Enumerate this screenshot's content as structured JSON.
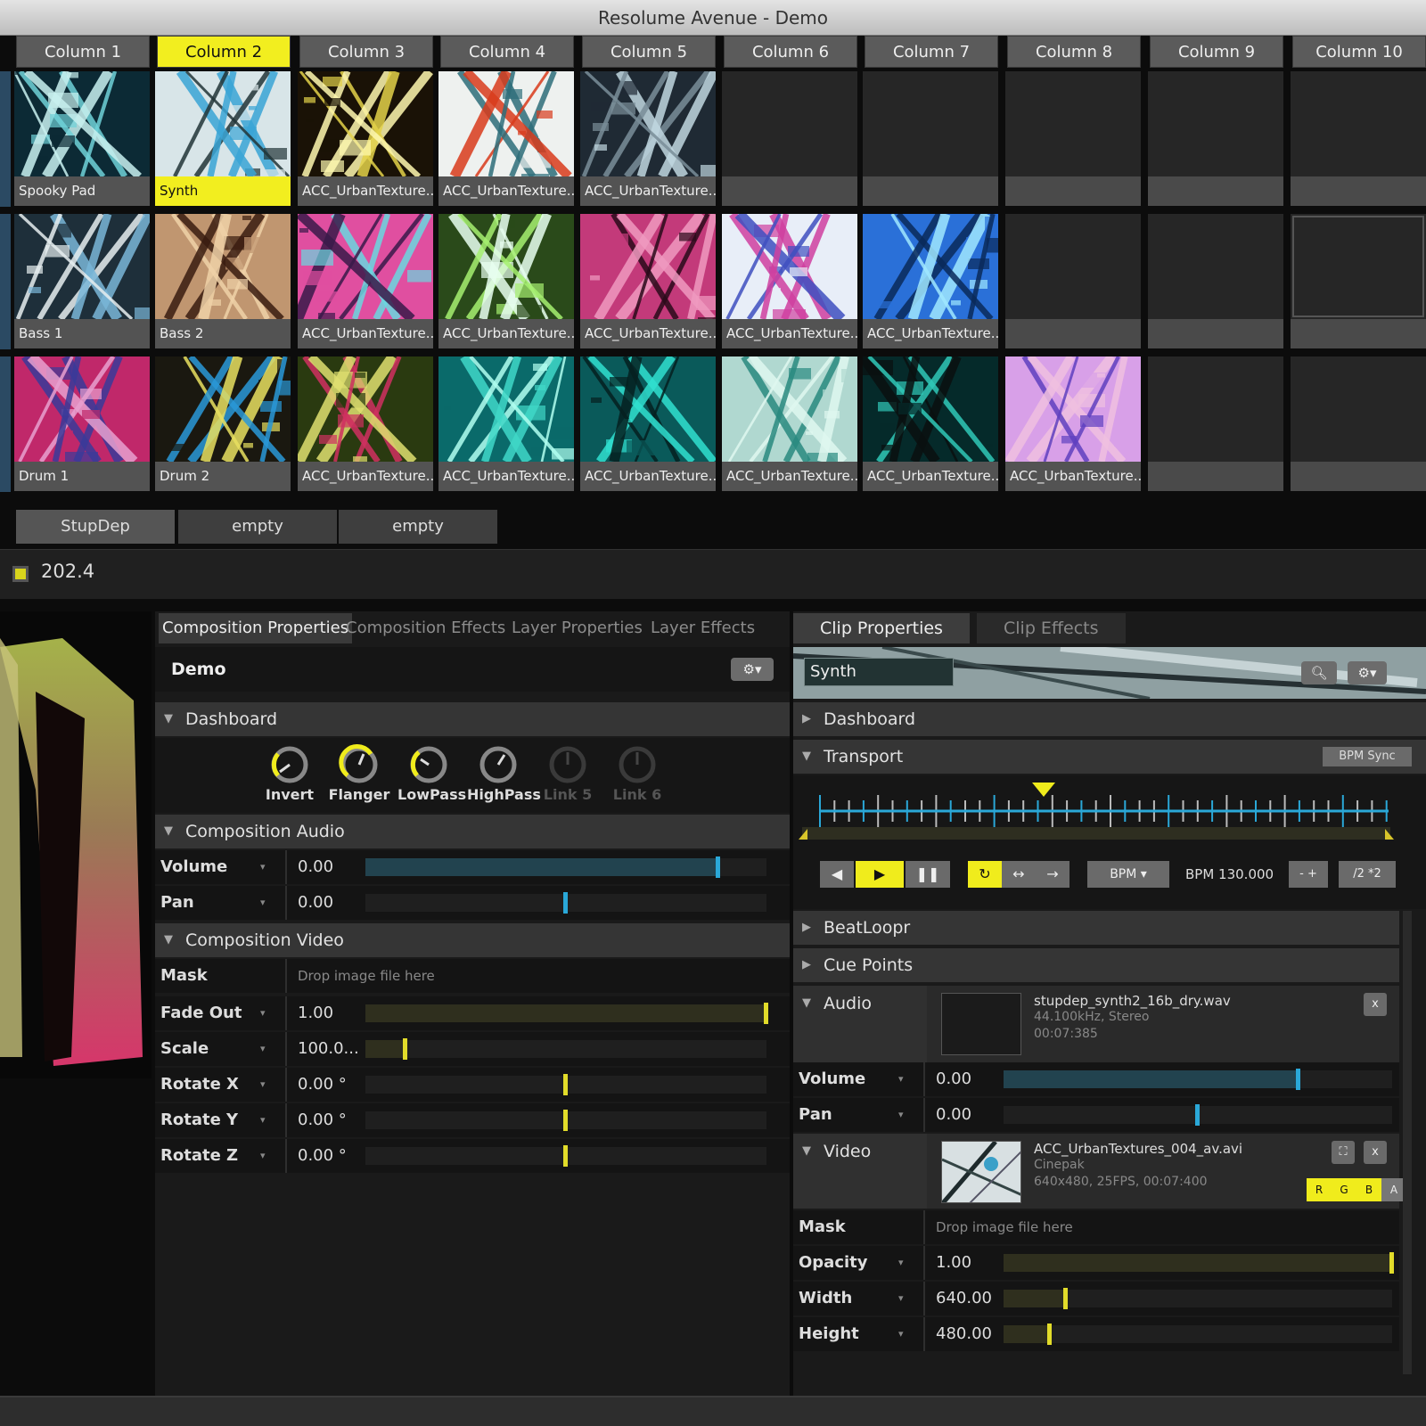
{
  "app": {
    "title": "Resolume Avenue - Demo"
  },
  "columns": [
    "Column 1",
    "Column 2",
    "Column 3",
    "Column 4",
    "Column 5",
    "Column 6",
    "Column 7",
    "Column 8",
    "Column 9",
    "Column 10"
  ],
  "layers": [
    {
      "clips": [
        "Spooky Pad",
        "Synth",
        "ACC_UrbanTexture...",
        "ACC_UrbanTexture...",
        "ACC_UrbanTexture...",
        "",
        "",
        "",
        "",
        ""
      ]
    },
    {
      "clips": [
        "Bass 1",
        "Bass 2",
        "ACC_UrbanTexture...",
        "ACC_UrbanTexture...",
        "ACC_UrbanTexture...",
        "ACC_UrbanTexture...",
        "ACC_UrbanTexture...",
        "",
        "",
        ""
      ]
    },
    {
      "clips": [
        "Drum 1",
        "Drum 2",
        "ACC_UrbanTexture...",
        "ACC_UrbanTexture...",
        "ACC_UrbanTexture...",
        "ACC_UrbanTexture...",
        "ACC_UrbanTexture...",
        "ACC_UrbanTexture...",
        "",
        ""
      ]
    }
  ],
  "decks": [
    "StupDep",
    "empty",
    "empty"
  ],
  "status": {
    "bpm": "202.4"
  },
  "composition": {
    "tabs": [
      "Composition Properties",
      "Composition Effects",
      "Layer Properties",
      "Layer Effects"
    ],
    "name": "Demo",
    "dashboard_label": "Dashboard",
    "knobs": [
      "Invert",
      "Flanger",
      "LowPass",
      "HighPass",
      "Link 5",
      "Link 6"
    ],
    "audio_label": "Composition Audio",
    "audio_rows": [
      {
        "label": "Volume",
        "value": "0.00"
      },
      {
        "label": "Pan",
        "value": "0.00"
      }
    ],
    "video_label": "Composition Video",
    "mask_label": "Mask",
    "mask_drop": "Drop image file here",
    "video_rows": [
      {
        "label": "Fade Out",
        "value": "1.00"
      },
      {
        "label": "Scale",
        "value": "100.0..."
      },
      {
        "label": "Rotate X",
        "value": "0.00 °"
      },
      {
        "label": "Rotate Y",
        "value": "0.00 °"
      },
      {
        "label": "Rotate Z",
        "value": "0.00 °"
      }
    ],
    "levels": {
      "volume": 0.88,
      "pan": 0.5,
      "fade_out": 1.0,
      "scale": 0.1,
      "rotate_x": 0.5,
      "rotate_y": 0.5,
      "rotate_z": 0.5
    }
  },
  "clip": {
    "tabs": [
      "Clip Properties",
      "Clip Effects"
    ],
    "name": "Synth",
    "dashboard_label": "Dashboard",
    "transport_label": "Transport",
    "bpm_sync": "BPM Sync",
    "bpm_mode": "BPM",
    "bpm_value": "BPM 130.000",
    "minus_plus": "- +",
    "half_double": "/2 *2",
    "beatloopr": "BeatLoopr",
    "cue_points": "Cue Points",
    "audio_label": "Audio",
    "audio_file": "stupdep_synth2_16b_dry.wav",
    "audio_info1": "44.100kHz, Stereo",
    "audio_info2": "00:07:385",
    "audio_rows": [
      {
        "label": "Volume",
        "value": "0.00"
      },
      {
        "label": "Pan",
        "value": "0.00"
      }
    ],
    "video_label": "Video",
    "video_file": "ACC_UrbanTextures_004_av.avi",
    "video_info1": "Cinepak",
    "video_info2": "640x480, 25FPS, 00:07:400",
    "rgba": [
      "R",
      "G",
      "B",
      "A"
    ],
    "x": "x",
    "mask_label": "Mask",
    "mask_drop": "Drop image file here",
    "video_rows": [
      {
        "label": "Opacity",
        "value": "1.00"
      },
      {
        "label": "Width",
        "value": "640.00"
      },
      {
        "label": "Height",
        "value": "480.00"
      }
    ],
    "levels": {
      "volume": 0.76,
      "pan": 0.5,
      "opacity": 1.0,
      "width": 0.16,
      "height": 0.12
    }
  },
  "colors": {
    "accent": "#f0ec1c",
    "blue": "#2aa8d8"
  }
}
